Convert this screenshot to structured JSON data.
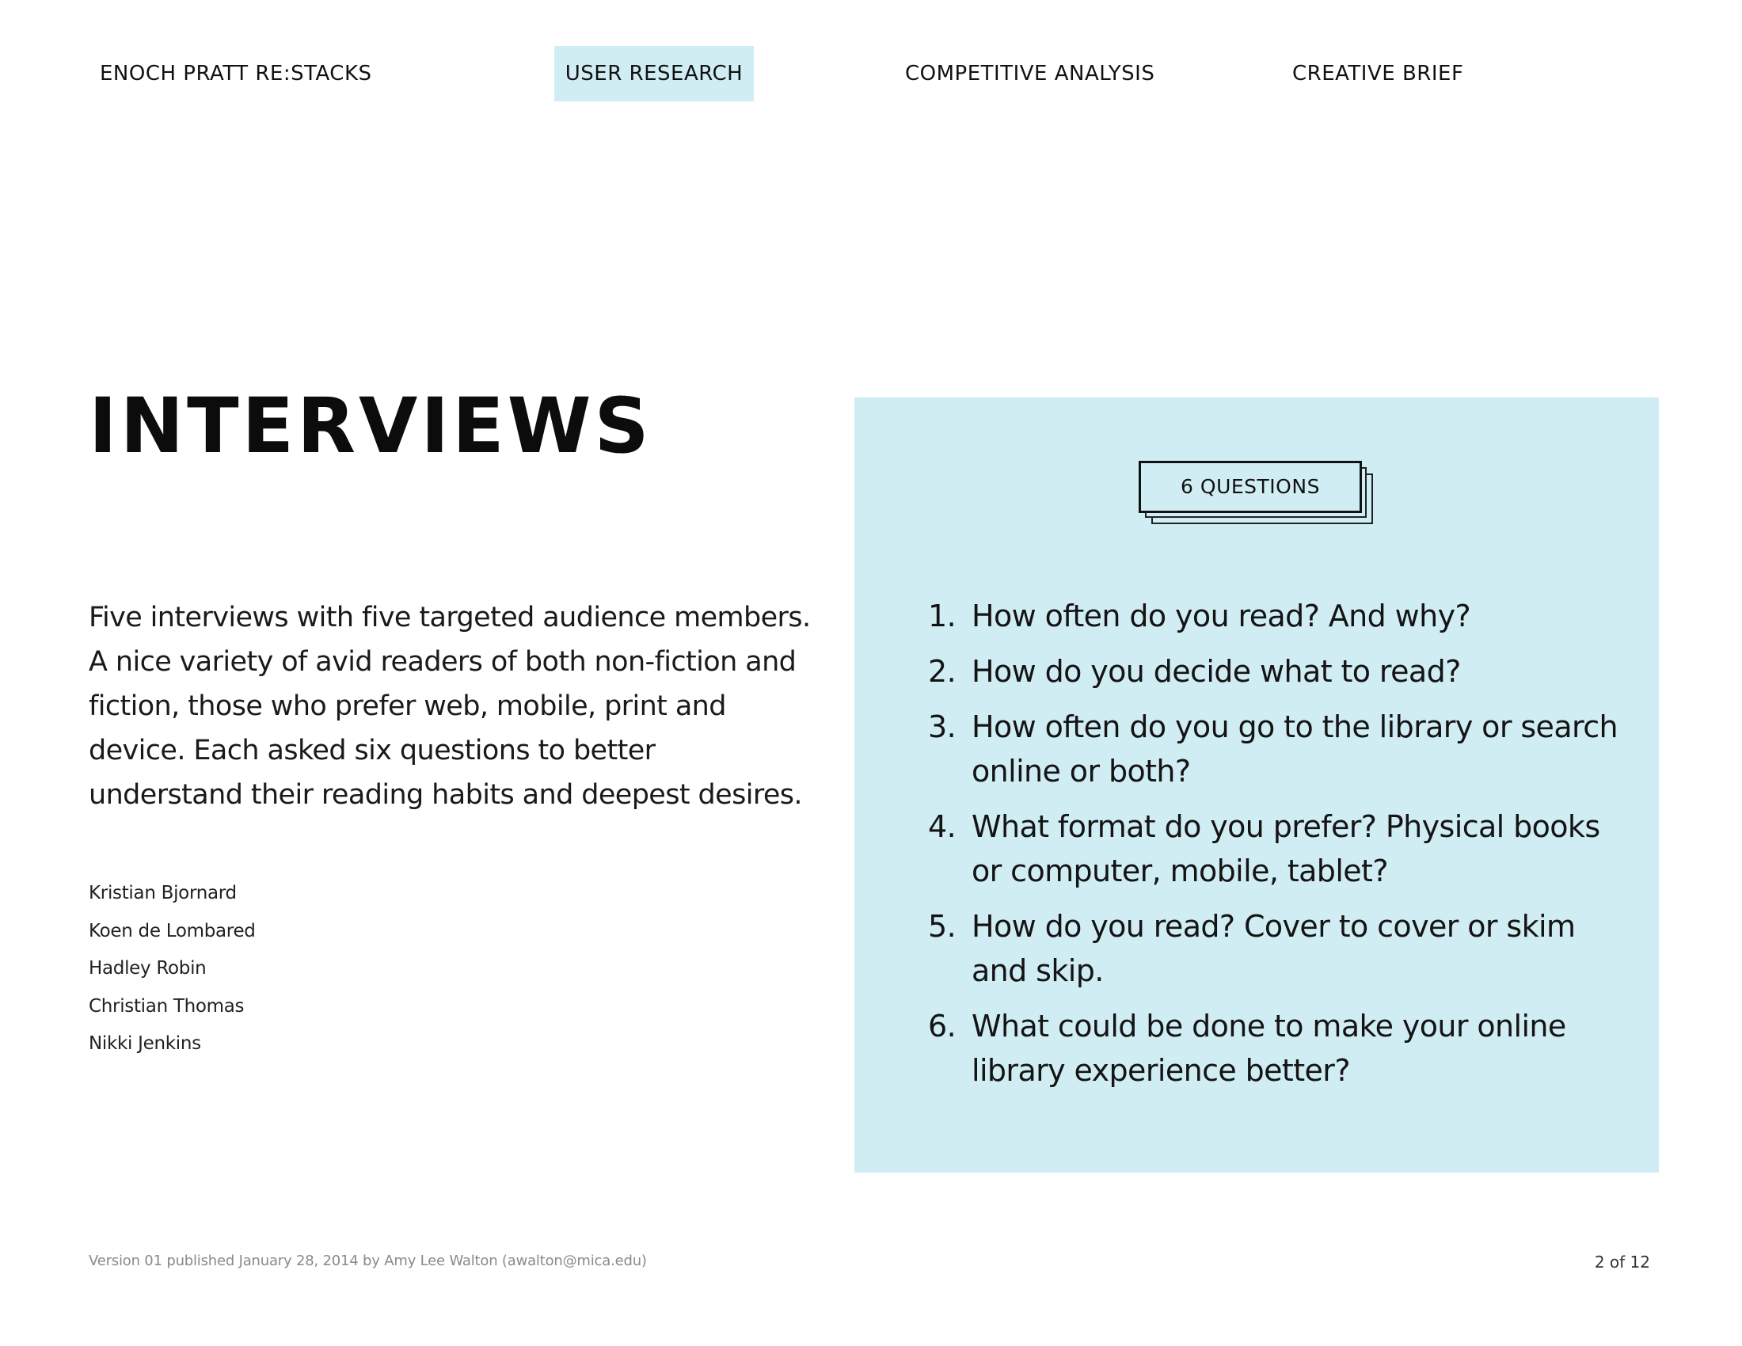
{
  "nav": {
    "brand": "ENOCH PRATT RE:STACKS",
    "items": [
      {
        "label": "USER RESEARCH",
        "active": true
      },
      {
        "label": "COMPETITIVE ANALYSIS",
        "active": false
      },
      {
        "label": "CREATIVE BRIEF",
        "active": false
      }
    ]
  },
  "main": {
    "title": "INTERVIEWS",
    "intro": "Five interviews with five targeted audience members. A nice variety of avid readers of both non-fiction and fiction, those who prefer web, mobile, print and device. Each asked six questions to better understand their reading habits and deepest desires.",
    "interviewees": [
      "Kristian Bjornard",
      "Koen de Lombared",
      "Hadley Robin",
      "Christian Thomas",
      "Nikki Jenkins"
    ]
  },
  "panel": {
    "badge": "6 QUESTIONS",
    "questions": [
      {
        "num": "1.",
        "text": "How often do you read? And why?"
      },
      {
        "num": "2.",
        "text": "How do you decide what to read?"
      },
      {
        "num": "3.",
        "text": "How often do you go to the library or search online or both?"
      },
      {
        "num": "4.",
        "text": "What format do you prefer? Physical books or computer, mobile, tablet?"
      },
      {
        "num": "5.",
        "text": "How do you read? Cover to cover or skim and skip."
      },
      {
        "num": "6.",
        "text": "What could be done to make your online library experience better?"
      }
    ]
  },
  "footer": {
    "meta": "Version 01 published January 28, 2014 by Amy Lee Walton (awalton@mica.edu)",
    "page": "2  of  12"
  },
  "colors": {
    "accent": "#d1edf4",
    "text": "#111111",
    "muted": "#8a8a8a"
  }
}
